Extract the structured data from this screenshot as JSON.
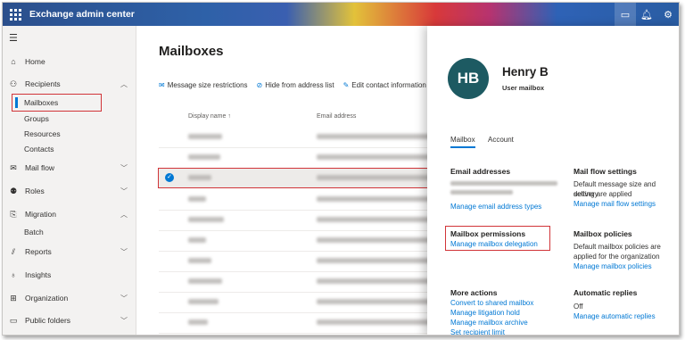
{
  "header": {
    "app_title": "Exchange admin center",
    "icons": [
      "waffle-icon",
      "terminal-icon",
      "bell-icon",
      "gear-icon"
    ]
  },
  "nav": {
    "items": [
      {
        "label": "Home",
        "icon": "home-icon"
      },
      {
        "label": "Recipients",
        "icon": "person-icon",
        "expanded": true
      },
      {
        "label": "Mail flow",
        "icon": "mail-icon"
      },
      {
        "label": "Roles",
        "icon": "roles-icon"
      },
      {
        "label": "Migration",
        "icon": "migration-icon",
        "expanded": true
      },
      {
        "label": "Reports",
        "icon": "chart-icon"
      },
      {
        "label": "Insights",
        "icon": "bulb-icon"
      },
      {
        "label": "Organization",
        "icon": "org-icon"
      },
      {
        "label": "Public folders",
        "icon": "folder-icon"
      }
    ],
    "recipients_sub": [
      "Mailboxes",
      "Groups",
      "Resources",
      "Contacts"
    ],
    "migration_sub": [
      "Batch"
    ]
  },
  "main": {
    "title": "Mailboxes",
    "commands": [
      "Message size restrictions",
      "Hide from address list",
      "Edit contact information"
    ],
    "columns": [
      "Display name ↑",
      "Email address"
    ],
    "selected_row": 2
  },
  "panel": {
    "initials": "HB",
    "name": "Henry B",
    "type": "User mailbox",
    "tabs": [
      "Mailbox",
      "Account"
    ],
    "email_addresses": {
      "title": "Email addresses",
      "link": "Manage email address types"
    },
    "mailbox_permissions": {
      "title": "Mailbox permissions",
      "link": "Manage mailbox delegation"
    },
    "more_actions": {
      "title": "More actions",
      "links": [
        "Convert to shared mailbox",
        "Manage litigation hold",
        "Manage mailbox archive",
        "Set recipient limit"
      ]
    },
    "mail_flow_settings": {
      "title": "Mail flow settings",
      "text": [
        "Default message size and delivery",
        "setting are applied"
      ],
      "link": "Manage mail flow settings"
    },
    "mailbox_policies": {
      "title": "Mailbox policies",
      "text": [
        "Default mailbox policies are",
        "applied for the organization"
      ],
      "link": "Manage mailbox policies"
    },
    "automatic_replies": {
      "title": "Automatic replies",
      "value": "Off",
      "link": "Manage automatic replies"
    }
  },
  "colors": {
    "accent": "#0078d4",
    "highlight": "#d13438",
    "avatar": "#1d5a62"
  }
}
